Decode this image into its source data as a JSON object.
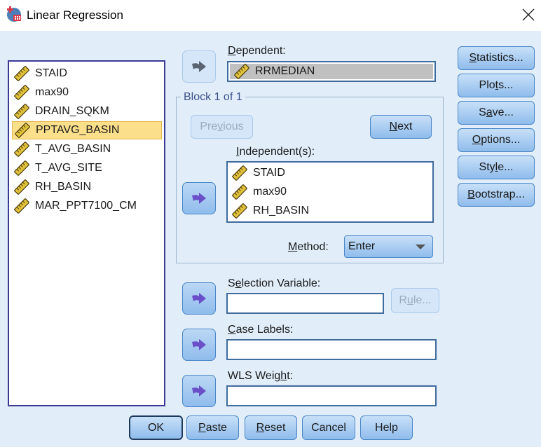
{
  "window": {
    "title": "Linear Regression",
    "icon": "spss-dialog-icon",
    "close_icon": "close-icon"
  },
  "source_variables": [
    {
      "name": "STAID",
      "icon": "scale-ruler-icon",
      "selected": false
    },
    {
      "name": "max90",
      "icon": "scale-ruler-icon",
      "selected": false
    },
    {
      "name": "DRAIN_SQKM",
      "icon": "scale-ruler-icon",
      "selected": false
    },
    {
      "name": "PPTAVG_BASIN",
      "icon": "scale-ruler-icon",
      "selected": true
    },
    {
      "name": "T_AVG_BASIN",
      "icon": "scale-ruler-icon",
      "selected": false
    },
    {
      "name": "T_AVG_SITE",
      "icon": "scale-ruler-icon",
      "selected": false
    },
    {
      "name": "RH_BASIN",
      "icon": "scale-ruler-icon",
      "selected": false
    },
    {
      "name": "MAR_PPT7100_CM",
      "icon": "scale-ruler-icon",
      "selected": false
    }
  ],
  "dependent": {
    "label": "Dependent:",
    "label_mnemonic": "D",
    "label_rest": "ependent:",
    "value": "RRMEDIAN"
  },
  "block": {
    "legend": "Block 1 of 1",
    "previous_label": "Previous",
    "next_label": "Next",
    "previous_enabled": false
  },
  "independents": {
    "label_mnemonic": "I",
    "label_rest": "ndependent(s):",
    "items": [
      "STAID",
      "max90",
      "RH_BASIN"
    ]
  },
  "method": {
    "label_mnemonic": "M",
    "label_rest": "ethod:",
    "value": "Enter"
  },
  "selection_variable": {
    "label_pre": "S",
    "label_mnemonic": "e",
    "label_rest": "lection Variable:",
    "value": "",
    "rule_label": "Rule...",
    "rule_enabled": false
  },
  "case_labels": {
    "label_mnemonic": "C",
    "label_rest": "ase Labels:",
    "value": ""
  },
  "wls_weight": {
    "label_pre": "WLS Weig",
    "label_mnemonic": "h",
    "label_rest": "t:",
    "value": ""
  },
  "side_buttons": [
    {
      "pre": "",
      "mn": "S",
      "rest": "tatistics..."
    },
    {
      "pre": "Plo",
      "mn": "t",
      "rest": "s..."
    },
    {
      "pre": "S",
      "mn": "a",
      "rest": "ve..."
    },
    {
      "pre": "",
      "mn": "O",
      "rest": "ptions..."
    },
    {
      "pre": "Sty",
      "mn": "l",
      "rest": "e..."
    },
    {
      "pre": "",
      "mn": "B",
      "rest": "ootstrap..."
    }
  ],
  "footer_buttons": {
    "ok": "OK",
    "paste_mn": "P",
    "paste_rest": "aste",
    "reset_mn": "R",
    "reset_rest": "eset",
    "cancel": "Cancel",
    "help": "Help"
  }
}
